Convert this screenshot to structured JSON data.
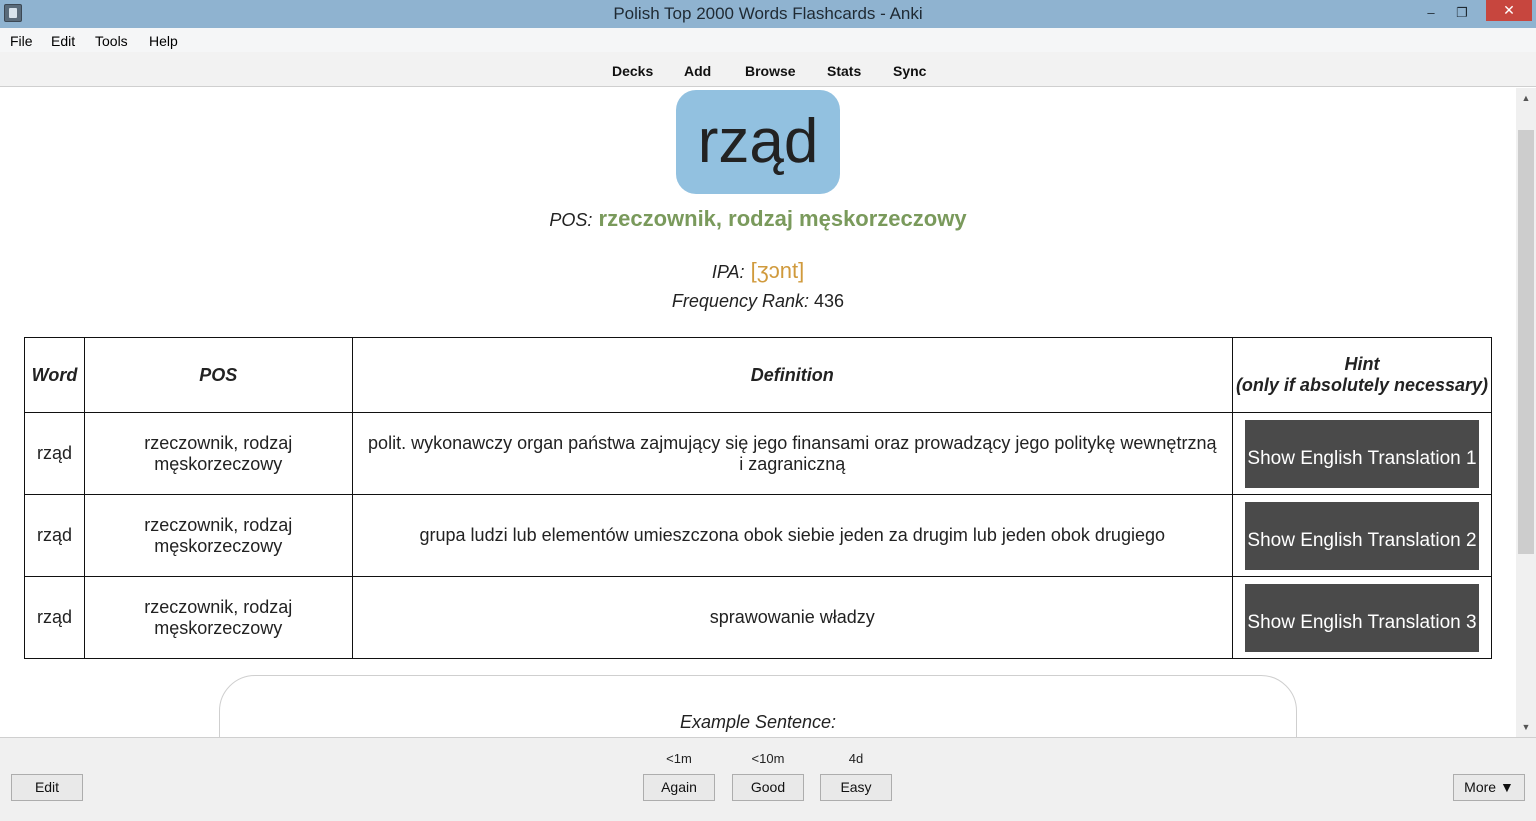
{
  "window": {
    "title": "Polish Top 2000 Words Flashcards - Anki",
    "controls": {
      "minimize": "–",
      "maximize": "❐",
      "close": "✕"
    },
    "icon": "anki-app-icon"
  },
  "menu": [
    "File",
    "Edit",
    "Tools",
    "Help"
  ],
  "toolbar": [
    "Decks",
    "Add",
    "Browse",
    "Stats",
    "Sync"
  ],
  "card": {
    "word": "rząd",
    "pos_label": "POS:",
    "pos_value": "rzeczownik, rodzaj męskorzeczowy",
    "ipa_label": "IPA:",
    "ipa_value": "[ʒɔnt]",
    "freq_label": "Frequency Rank:",
    "freq_value": "436",
    "colors": {
      "word_bg": "#92c1e0",
      "pos": "#7a9a5c",
      "ipa": "#d09a3c"
    }
  },
  "table": {
    "headers": {
      "word": "Word",
      "pos": "POS",
      "definition": "Definition",
      "hint_line1": "Hint",
      "hint_line2": "(only if absolutely necessary)"
    },
    "rows": [
      {
        "word": "rząd",
        "pos": "rzeczownik, rodzaj męskorzeczowy",
        "definition": "polit. wykonawczy organ państwa zajmujący się jego finansami oraz prowadzący jego politykę wewnętrzną i zagraniczną",
        "hint": "Show English Translation 1"
      },
      {
        "word": "rząd",
        "pos": "rzeczownik, rodzaj męskorzeczowy",
        "definition": "grupa ludzi lub elementów umieszczona obok siebie jeden za drugim lub jeden obok drugiego",
        "hint": "Show English Translation 2"
      },
      {
        "word": "rząd",
        "pos": "rzeczownik, rodzaj męskorzeczowy",
        "definition": "sprawowanie władzy",
        "hint": "Show English Translation 3"
      }
    ]
  },
  "example": {
    "label": "Example Sentence:"
  },
  "bottom": {
    "edit": "Edit",
    "answers": [
      {
        "interval": "<1m",
        "label": "Again"
      },
      {
        "interval": "<10m",
        "label": "Good"
      },
      {
        "interval": "4d",
        "label": "Easy"
      }
    ],
    "more": "More ▼"
  }
}
